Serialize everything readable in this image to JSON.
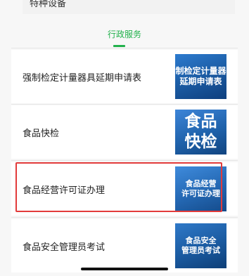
{
  "top_card": {
    "label": "特种设备"
  },
  "section": {
    "tab_label": "行政服务",
    "accent": "#22b14c"
  },
  "services": [
    {
      "label": "强制检定计量器具延期申请表",
      "thumb_line1": "制检定计量器",
      "thumb_line2": "延期申请表"
    },
    {
      "label": "食品快检",
      "thumb_line1": "食品",
      "thumb_line2": "快检"
    },
    {
      "label": "食品经营许可证办理",
      "thumb_line1": "食品经营",
      "thumb_line2": "许可证办理"
    },
    {
      "label": "食品安全管理员考试",
      "thumb_line1": "食品安全",
      "thumb_line2": "管理员考试"
    }
  ],
  "highlight_color": "#e23b3b"
}
